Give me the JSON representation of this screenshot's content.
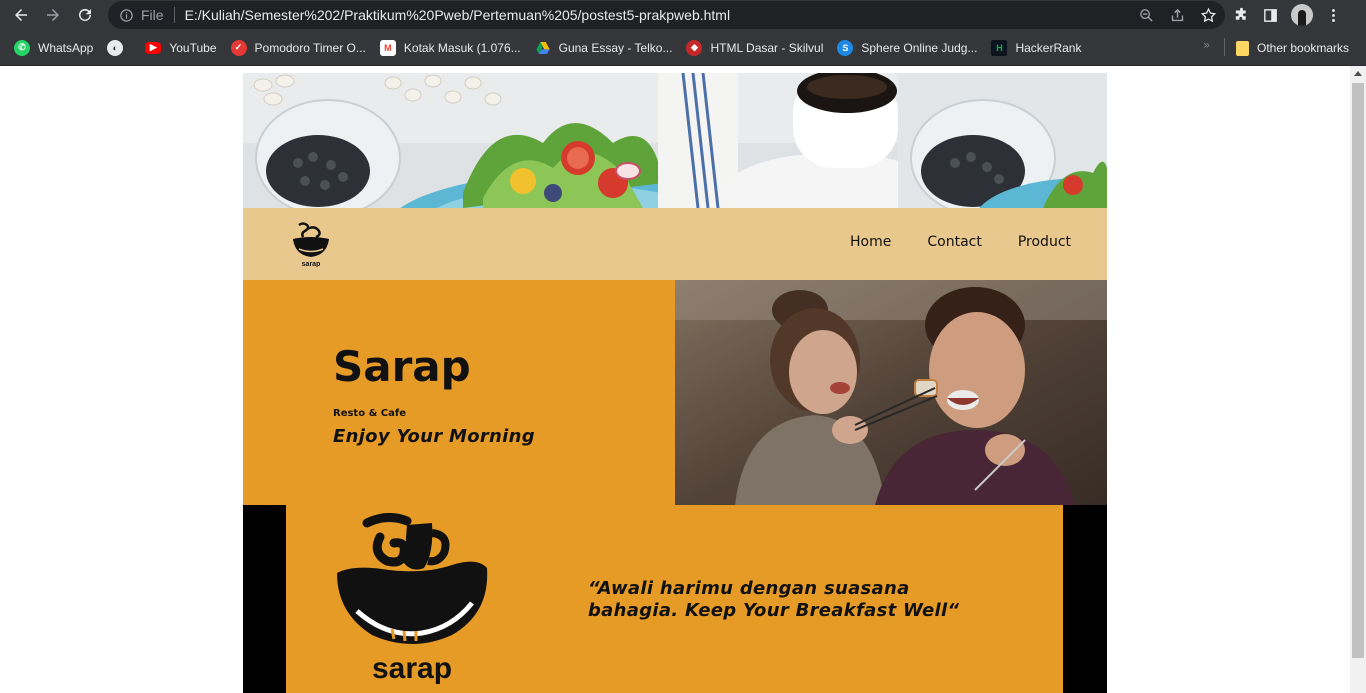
{
  "browser": {
    "url_scheme_label": "File",
    "url": "E:/Kuliah/Semester%202/Praktikum%20Pweb/Pertemuan%205/postest5-prakpweb.html",
    "bookmarks": [
      {
        "label": "WhatsApp",
        "icon": "whatsapp-icon",
        "color": "#25d366"
      },
      {
        "label": "",
        "icon": "globe-icon",
        "color": "#e8eaed"
      },
      {
        "label": "YouTube",
        "icon": "youtube-icon",
        "color": "#ff0000"
      },
      {
        "label": "Pomodoro Timer O...",
        "icon": "pomodoro-icon",
        "color": "#e53935"
      },
      {
        "label": "Kotak Masuk (1.076...",
        "icon": "gmail-icon",
        "color": "#ea4335"
      },
      {
        "label": "Guna Essay - Telko...",
        "icon": "drive-icon",
        "color": "#fbbc04"
      },
      {
        "label": "HTML Dasar - Skilvul",
        "icon": "skilvul-icon",
        "color": "#c62828"
      },
      {
        "label": "Sphere Online Judg...",
        "icon": "spoj-icon",
        "color": "#1e88e5"
      },
      {
        "label": "HackerRank",
        "icon": "hackerrank-icon",
        "color": "#1ba94c"
      }
    ],
    "more_label": "»",
    "other_bookmarks": "Other bookmarks"
  },
  "site": {
    "nav": {
      "logo_text": "sarap",
      "links": [
        "Home",
        "Contact",
        "Product"
      ]
    },
    "hero": {
      "title": "Sarap",
      "subtitle": "Resto & Cafe",
      "tagline": "Enjoy Your Morning"
    },
    "quote": {
      "logo_text": "sarap",
      "text": "“Awali harimu dengan suasana bahagia. Keep Your Breakfast Well“"
    }
  },
  "colors": {
    "nav_bg": "#e9c88e",
    "accent_orange": "#e79b27",
    "dark": "#111111"
  }
}
